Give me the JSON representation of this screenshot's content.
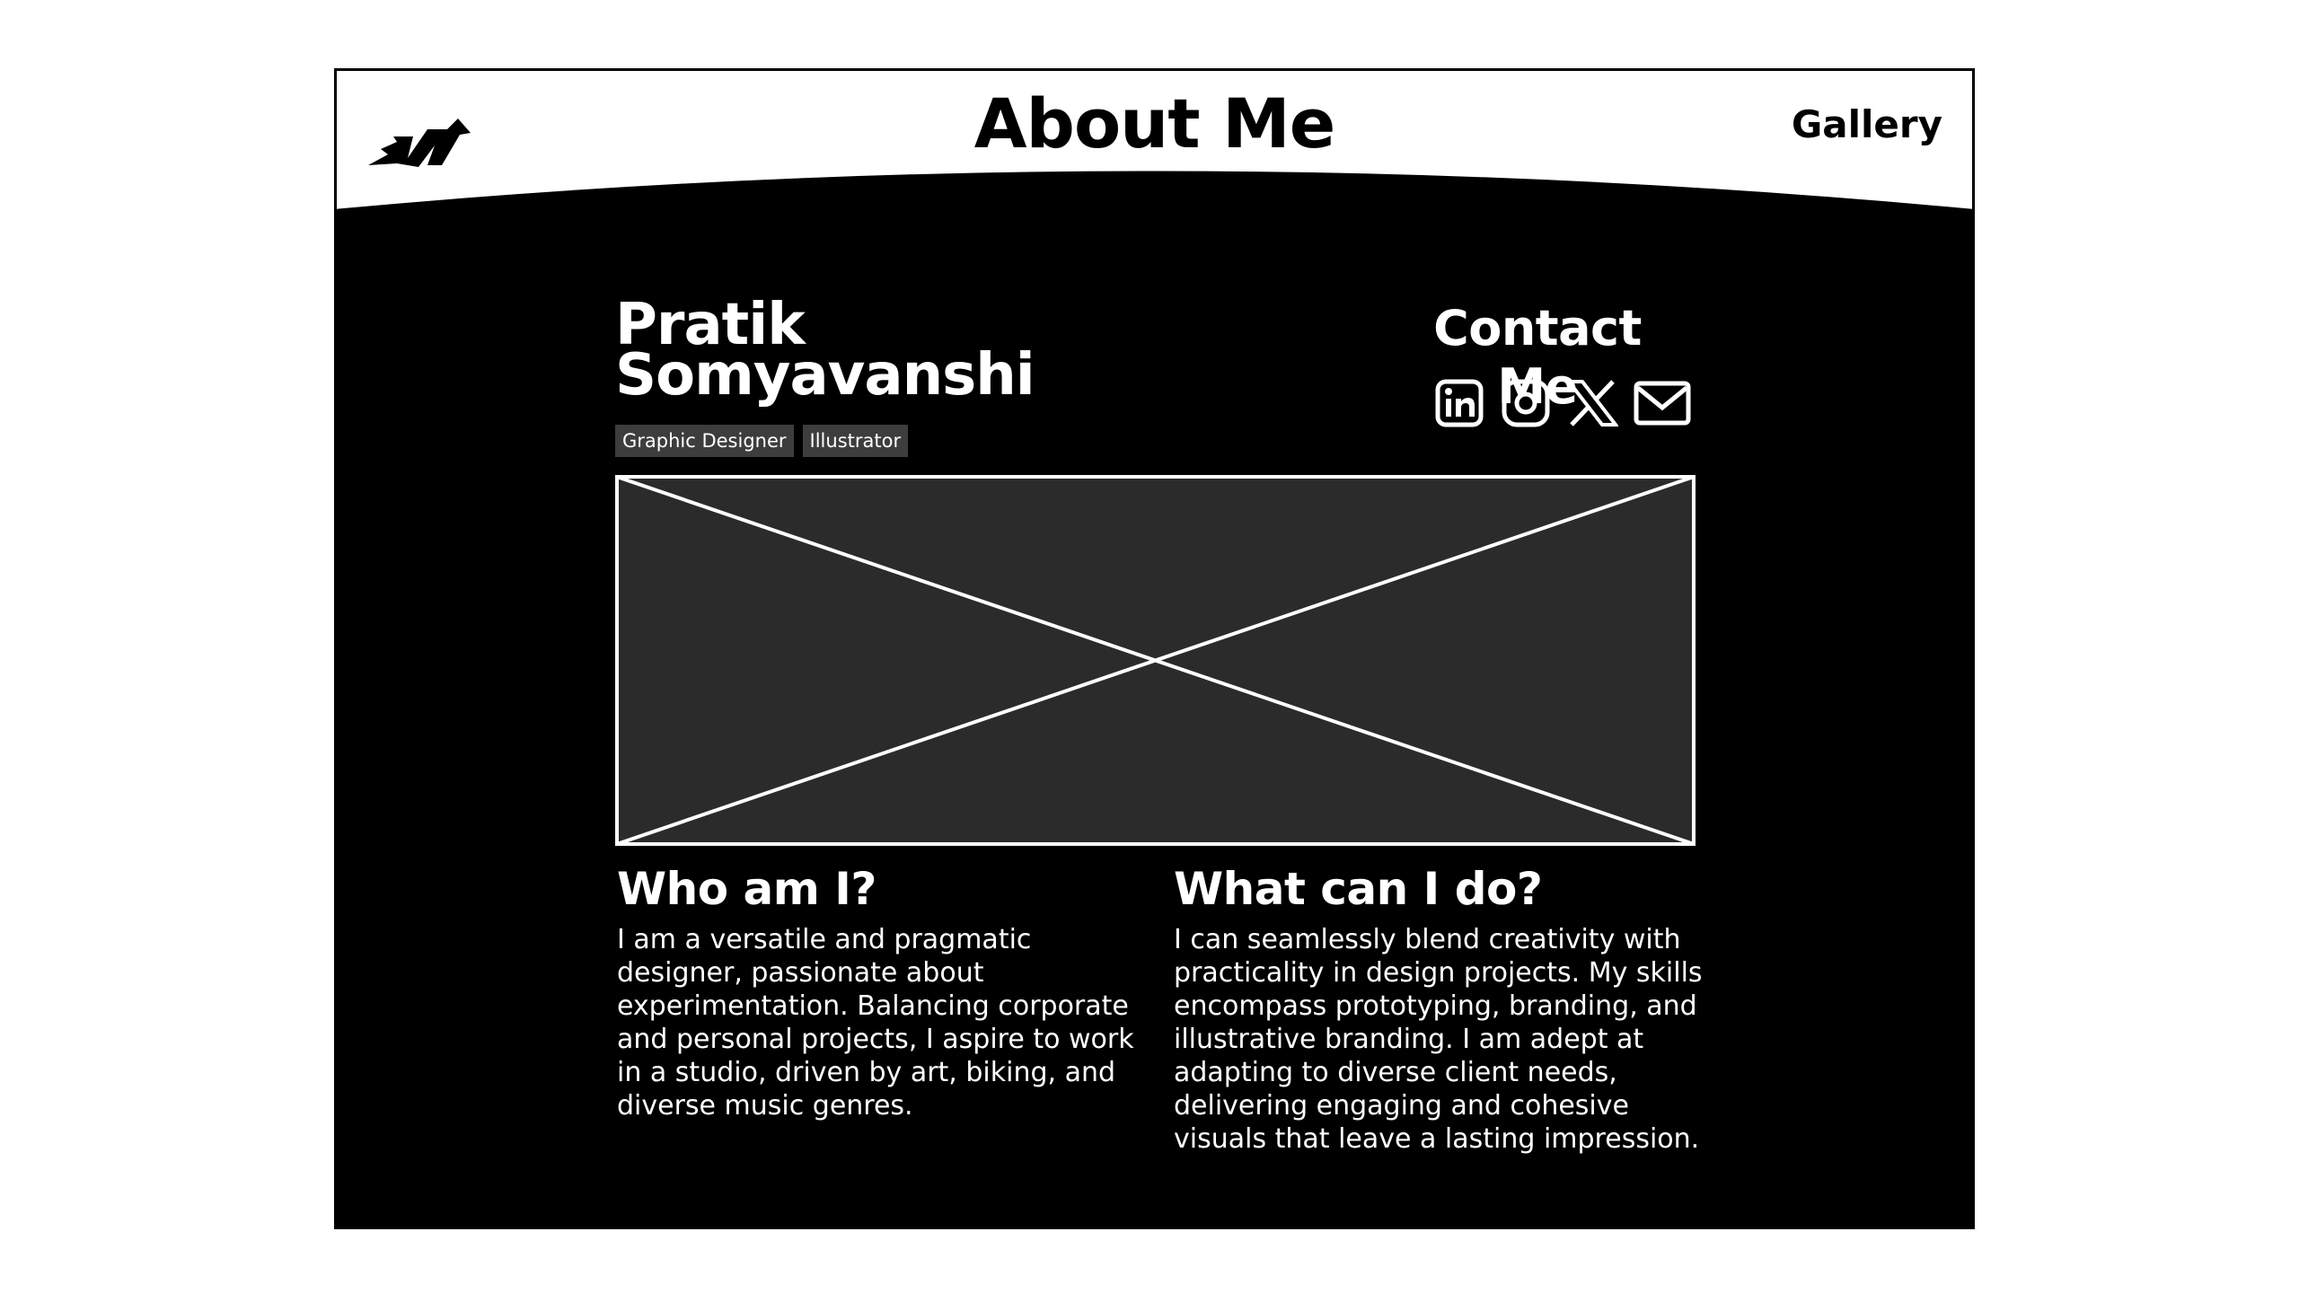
{
  "header": {
    "title": "About Me",
    "nav_gallery": "Gallery",
    "logo_icon": "bird-logo-icon"
  },
  "profile": {
    "name_line1": "Pratik",
    "name_line2": "Somyavanshi",
    "tags": [
      "Graphic Designer",
      "Illustrator"
    ]
  },
  "contact": {
    "title": "Contact Me",
    "icons": [
      "linkedin-icon",
      "instagram-icon",
      "x-icon",
      "mail-icon"
    ]
  },
  "hero_image": {
    "icon": "image-placeholder-icon"
  },
  "who": {
    "title": "Who am I?",
    "text": "I am a versatile and pragmatic designer, passionate about experimentation. Balancing corporate and personal projects, I aspire to work in a studio, driven by art, biking, and diverse music genres."
  },
  "what": {
    "title": "What can I do?",
    "text": "I can seamlessly blend creativity with practicality in design projects. My skills encompass prototyping, branding, and illustrative branding. I am adept at adapting to diverse client needs, delivering engaging and cohesive visuals that leave a lasting impression."
  },
  "colors": {
    "background": "#000000",
    "header": "#ffffff",
    "tag_bg": "#3d3d3d",
    "placeholder_fill": "#2b2b2b"
  }
}
